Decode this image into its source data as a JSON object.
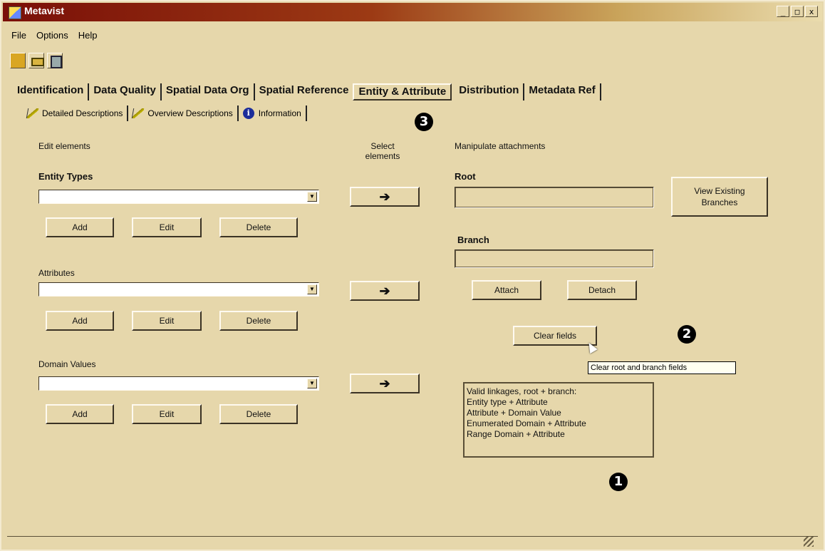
{
  "window": {
    "title": "Metavist",
    "controls": [
      "_",
      "□",
      "x"
    ]
  },
  "menu": [
    "File",
    "Options",
    "Help"
  ],
  "main_tabs": [
    "Identification",
    "Data Quality",
    "Spatial Data Org",
    "Spatial Reference",
    "Entity & Attribute",
    "Distribution",
    "Metadata Ref"
  ],
  "active_main_tab": "Entity & Attribute",
  "sub_tabs": [
    "Detailed Descriptions",
    "Overview Descriptions",
    "Information"
  ],
  "callouts": {
    "one": "1",
    "two": "2",
    "three": "3"
  },
  "left": {
    "header": "Edit elements",
    "entity_types_label": "Entity Types",
    "attributes_label": "Attributes",
    "domain_values_label": "Domain Values",
    "add": "Add",
    "edit": "Edit",
    "delete": "Delete"
  },
  "middle": {
    "header_line1": "Select",
    "header_line2": "elements",
    "arrow": "➔"
  },
  "right": {
    "header": "Manipulate attachments",
    "root_label": "Root",
    "branch_label": "Branch",
    "view_existing_line1": "View Existing",
    "view_existing_line2": "Branches",
    "attach": "Attach",
    "detach": "Detach",
    "clear_fields": "Clear fields",
    "tooltip": "Clear root and branch fields",
    "info_lines": [
      "Valid linkages, root + branch:",
      "Entity type + Attribute",
      "Attribute + Domain Value",
      "Enumerated Domain + Attribute",
      "Range Domain + Attribute"
    ]
  }
}
